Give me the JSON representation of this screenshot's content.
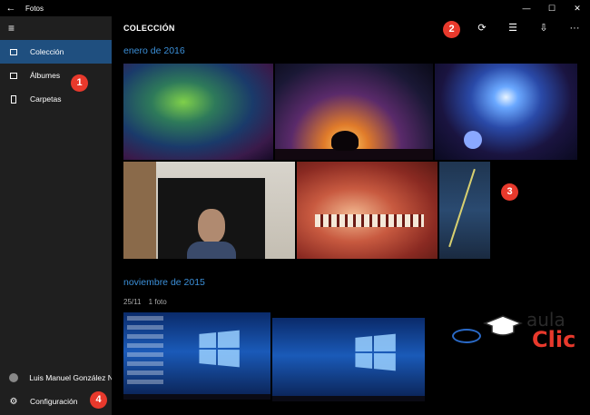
{
  "window": {
    "back_icon": "back-arrow-icon",
    "title": "Fotos",
    "minimize_icon": "minimize-icon",
    "maximize_icon": "maximize-icon",
    "close_icon": "close-icon"
  },
  "sidebar": {
    "menu_icon": "hamburger-icon",
    "items": [
      {
        "label": "Colección",
        "icon": "collection-icon",
        "active": true
      },
      {
        "label": "Álbumes",
        "icon": "albums-icon",
        "active": false
      },
      {
        "label": "Carpetas",
        "icon": "folders-icon",
        "active": false
      }
    ],
    "user_name": "Luis Manuel González Na",
    "settings_label": "Configuración"
  },
  "toolbar": {
    "title": "COLECCIÓN",
    "tools": [
      "refresh-icon",
      "select-icon",
      "import-icon",
      "more-icon"
    ]
  },
  "sections": [
    {
      "title": "enero de 2016"
    },
    {
      "title": "noviembre de 2015",
      "date": "25/11",
      "count": "1 foto"
    }
  ],
  "callouts": [
    "1",
    "2",
    "3",
    "4"
  ],
  "logo": {
    "line1": "aula",
    "line2": "Clic"
  },
  "colors": {
    "accent": "#3b8fd8",
    "active_item": "#1f4f7f",
    "callout": "#e8392c",
    "sidebar": "#1f1f1f"
  }
}
